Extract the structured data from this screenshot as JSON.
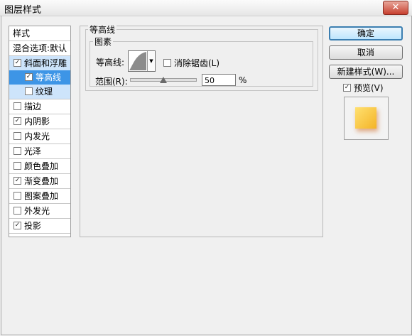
{
  "window": {
    "title": "图层样式",
    "close_glyph": "✕"
  },
  "sidebar": {
    "styles_label": "样式",
    "blend_label": "混合选项:默认",
    "items": [
      {
        "label": "斜面和浮雕",
        "checked": true
      },
      {
        "label": "等高线",
        "checked": true
      },
      {
        "label": "纹理",
        "checked": false
      },
      {
        "label": "描边",
        "checked": false
      },
      {
        "label": "内阴影",
        "checked": true
      },
      {
        "label": "内发光",
        "checked": false
      },
      {
        "label": "光泽",
        "checked": false
      },
      {
        "label": "颜色叠加",
        "checked": false
      },
      {
        "label": "渐变叠加",
        "checked": true
      },
      {
        "label": "图案叠加",
        "checked": false
      },
      {
        "label": "外发光",
        "checked": false
      },
      {
        "label": "投影",
        "checked": true
      }
    ]
  },
  "panel": {
    "group_title": "等高线",
    "subgroup_title": "图素",
    "contour_label": "等高线:",
    "antialias_label": "消除锯齿(L)",
    "antialias_checked": false,
    "range_label": "范围(R):",
    "range_value": "50",
    "range_unit": "%",
    "range_fraction": 0.5
  },
  "buttons": {
    "ok": "确定",
    "cancel": "取消",
    "new_style": "新建样式(W)..."
  },
  "preview": {
    "label": "预览(V)",
    "checked": true
  },
  "checkmark": "✓"
}
